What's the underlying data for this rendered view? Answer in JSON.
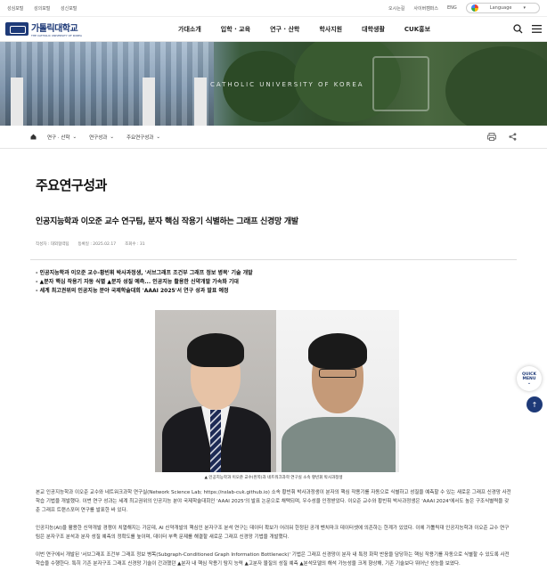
{
  "utility": {
    "left": [
      "성심포털",
      "성의포털",
      "성신포털"
    ],
    "right": [
      "오시는길",
      "사이버캠퍼스",
      "ENG"
    ],
    "language": "Language"
  },
  "logo": {
    "name": "가톨릭대학교",
    "sub": "THE CATHOLIC UNIVERSITY OF KOREA"
  },
  "menu": [
    "가대소개",
    "입학 · 교육",
    "연구 · 산학",
    "학사지원",
    "대학생활",
    "CUK홍보"
  ],
  "hero": {
    "text": "CATHOLIC UNIVERSITY OF KOREA"
  },
  "breadcrumb": {
    "items": [
      "연구 · 산학",
      "연구성과",
      "주요연구성과"
    ]
  },
  "page_title": "주요연구성과",
  "article": {
    "title": "인공지능학과 이오준 교수 연구팀, 분자 핵심 작용기 식별하는 그래프 신경망 개발",
    "meta": {
      "author": "작성자 : 대외협력팀",
      "date": "등록일 : 2025.02.17",
      "views": "조회수 : 31"
    },
    "summary": [
      "- 인공지능학과 이오준 교수-황빈휘 박사과정생, '서브그래프 조건부 그래프 정보 병목' 기술 개발",
      "- ▲분자 핵심 작용기 자동 식별 ▲분자 성질 예측... 인공지능 활용한 신약개발 가속화 기대",
      "- 세계 최고권위의 인공지능 분야 국제학술대회 'AAAI 2025'서 연구 성과 발표 예정"
    ],
    "caption": "▲ 인공지능학과 이오준 교수(왼쪽)과 네트워크과학 연구실 소속 황빈휘 박사과정생",
    "paragraphs": [
      "본교 인공지능학과 이오준 교수와 네트워크과학 연구실(Network Science Lab; https://nslab-cuk.github.io) 소속 황빈휘 박사과정생이 분자의 핵심 작용기를 자동으로 식별하고 성질을 예측할 수 있는 새로운 그래프 신경망 사전학습 기법을 개발했다. 이번 연구 성과는 세계 최고권위의 인공지능 분야 국제학술대회인 'AAAI 2025'의 발표 논문으로 채택되며, 우수성을 인정받았다. 이오준 교수와 황빈휘 박사과정생은 'AAAI 2024'에서도 높은 구조식별력을 갖춘 그래프 트랜스포머 연구를 발표한 바 있다.",
      "인공지능(AI)을 활용한 신약개발 경쟁이 치열해지는 가운데, AI 신약개발의 핵심인 분자구조 분석 연구는 데이터 확보가 어려워 한정된 공개 벤치마크 데이터셋에 의존하는 한계가 있었다. 이에 가톨릭대 인공지능학과 이오준 교수 연구팀은 분자구조 분석과 분자 성질 예측의 정확도를 높이며, 데이터 부족 문제를 해결할 새로운 그래프 신경망 기법을 개발했다.",
      "이번 연구에서 개발된 '서브그래프 조건부 그래프 정보 병목(Subgraph-Conditioned Graph Information Bottleneck)' 기법은 그래프 신경망이 분자 내 특정 화학 반응을 담당하는 핵심 작용기를 자동으로 식별할 수 있도록 사전학습을 수행한다. 특히 기존 분자구조 그래프 신경망 기술이 간과했던 ▲분자 내 핵심 작용기 탐지 능력 ▲고분자 물질의 성질 예측 ▲분석모델의 해석 가능성을 크게 향상해, 기존 기술보다 뛰어난 성능을 보였다."
    ]
  },
  "quick_menu": {
    "line1": "QUICK",
    "line2": "MENU"
  },
  "colors": {
    "brand": "#1e3a78"
  }
}
